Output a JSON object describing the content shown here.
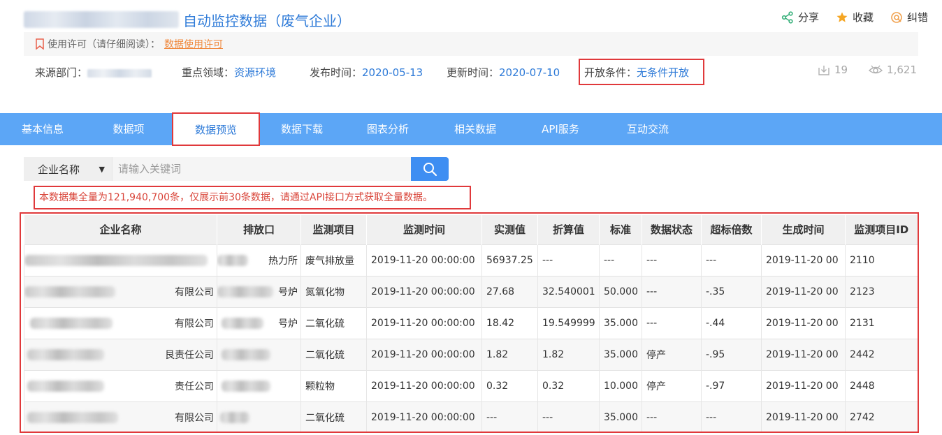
{
  "header": {
    "title": "自动监控数据（废气企业）",
    "actions": [
      {
        "icon": "share-icon",
        "label": "分享"
      },
      {
        "icon": "star-icon",
        "label": "收藏"
      },
      {
        "icon": "error-icon",
        "label": "纠错"
      }
    ]
  },
  "license": {
    "label": "使用许可（请仔细阅读）：",
    "link": "数据使用许可"
  },
  "meta": {
    "source_label": "来源部门：",
    "field_label": "重点领域：",
    "field_value": "资源环境",
    "publish_label": "发布时间：",
    "publish_value": "2020-05-13",
    "update_label": "更新时间：",
    "update_value": "2020-07-10",
    "open_label": "开放条件：",
    "open_value": "无条件开放"
  },
  "stats": {
    "downloads": "19",
    "views": "1,621"
  },
  "tabs": [
    "基本信息",
    "数据项",
    "数据预览",
    "数据下载",
    "图表分析",
    "相关数据",
    "API服务",
    "互动交流"
  ],
  "active_tab": "数据预览",
  "search": {
    "select_value": "企业名称",
    "placeholder": "请输入关键词"
  },
  "notice": "本数据集全量为121,940,700条，仅展示前30条数据，请通过API接口方式获取全量数据。",
  "table": {
    "headers": [
      "企业名称",
      "排放口",
      "监测项目",
      "监测时间",
      "实测值",
      "折算值",
      "标准",
      "数据状态",
      "超标倍数",
      "生成时间",
      "监测项目ID"
    ],
    "rows": [
      [
        "",
        "热力所",
        "废气排放量",
        "2019-11-20 00:00:00",
        "56937.25",
        "---",
        "---",
        "---",
        "---",
        "2019-11-20 00",
        "2110"
      ],
      [
        "有限公司",
        "号炉",
        "氮氧化物",
        "2019-11-20 00:00:00",
        "27.68",
        "32.540001",
        "50.000",
        "---",
        "-.35",
        "2019-11-20 00",
        "2123"
      ],
      [
        "有限公司",
        "号炉",
        "二氧化硫",
        "2019-11-20 00:00:00",
        "18.42",
        "19.549999",
        "35.000",
        "---",
        "-.44",
        "2019-11-20 00",
        "2131"
      ],
      [
        "艮责任公司",
        "",
        "二氧化硫",
        "2019-11-20 00:00:00",
        "1.82",
        "1.82",
        "35.000",
        "停产",
        "-.95",
        "2019-11-20 00",
        "2442"
      ],
      [
        "责任公司",
        "",
        "颗粒物",
        "2019-11-20 00:00:00",
        "0.32",
        "0.32",
        "10.000",
        "停产",
        "-.97",
        "2019-11-20 00",
        "2448"
      ],
      [
        "有限公司",
        "",
        "二氧化硫",
        "2019-11-20 00:00:00",
        "---",
        "---",
        "35.000",
        "---",
        "---",
        "2019-11-20 00",
        "2742"
      ]
    ]
  },
  "colors": {
    "accent": "#2f7bd8",
    "tab_bar": "#5ca6f6",
    "highlight_border": "#e0393b",
    "license_link": "#f0883c",
    "notice_text": "#d9453a"
  }
}
